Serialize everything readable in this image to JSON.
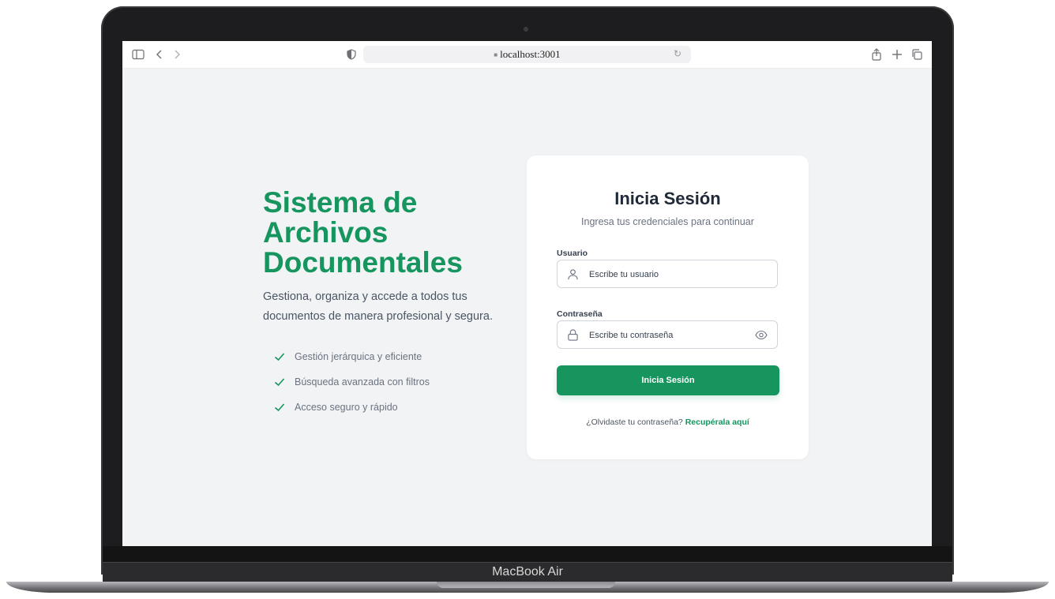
{
  "device": {
    "label": "MacBook Air"
  },
  "browser": {
    "url": "localhost:3001",
    "icons": [
      "sidebar-icon",
      "back-icon",
      "forward-icon",
      "privacy-shield-icon",
      "lock-icon",
      "reload-icon",
      "share-icon",
      "new-tab-icon",
      "tabs-overview-icon"
    ]
  },
  "hero": {
    "title": "Sistema de Archivos Documentales",
    "subtitle": "Gestiona, organiza y accede a todos tus documentos de manera profesional y segura.",
    "features": [
      "Gestión jerárquica y eficiente",
      "Búsqueda avanzada con filtros",
      "Acceso seguro y rápido"
    ]
  },
  "login": {
    "title": "Inicia Sesión",
    "subtitle": "Ingresa tus credenciales para continuar",
    "username_label": "Usuario",
    "username_placeholder": "Escribe tu usuario",
    "password_label": "Contraseña",
    "password_placeholder": "Escribe tu contraseña",
    "submit_label": "Inicia Sesión",
    "forgot_text": "¿Olvidaste tu contraseña?",
    "forgot_link": "Recupérala aquí"
  },
  "colors": {
    "brand": "#16955e",
    "page_background": "#f2f3f5",
    "card": "#ffffff",
    "heading": "#1f2937"
  }
}
